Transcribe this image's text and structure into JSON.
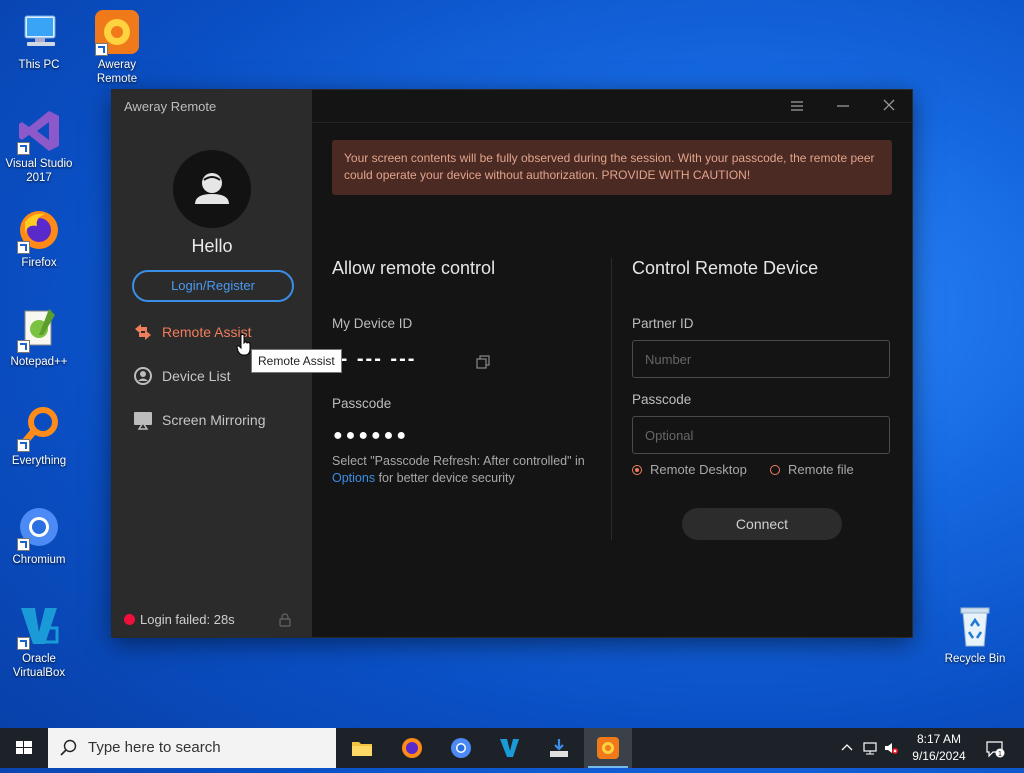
{
  "desktop": {
    "icons": [
      {
        "label": "This PC",
        "icon": "computer-icon"
      },
      {
        "label": "Aweray Remote",
        "icon": "aweray-icon"
      },
      {
        "label": "Visual Studio 2017",
        "icon": "visual-studio-icon"
      },
      {
        "label": "Firefox",
        "icon": "firefox-icon"
      },
      {
        "label": "Notepad++",
        "icon": "notepadpp-icon"
      },
      {
        "label": "Everything",
        "icon": "everything-icon"
      },
      {
        "label": "Chromium",
        "icon": "chromium-icon"
      },
      {
        "label": "Oracle VirtualBox",
        "icon": "virtualbox-icon"
      },
      {
        "label": "Recycle Bin",
        "icon": "recycle-bin-icon"
      }
    ]
  },
  "app": {
    "title": "Aweray Remote",
    "sidebar": {
      "greeting": "Hello",
      "login_button": "Login/Register",
      "nav": [
        {
          "label": "Remote Assist",
          "icon": "remote-assist-icon",
          "active": true
        },
        {
          "label": "Device List",
          "icon": "device-list-icon",
          "active": false
        },
        {
          "label": "Screen Mirroring",
          "icon": "screen-mirroring-icon",
          "active": false
        }
      ],
      "status": "Login failed: 28s"
    },
    "warning": "Your screen contents will be fully observed during the session. With your passcode, the remote peer could operate your device without authorization. PROVIDE WITH CAUTION!",
    "allow": {
      "title": "Allow remote control",
      "device_id_label": "My Device ID",
      "device_id_value": "-- --- ---",
      "passcode_label": "Passcode",
      "passcode_value": "●●●●●●",
      "hint_prefix": "Select \"Passcode Refresh: After controlled\" in ",
      "hint_link": "Options",
      "hint_suffix": " for better device security"
    },
    "control": {
      "title": "Control Remote Device",
      "partner_label": "Partner ID",
      "partner_placeholder": "Number",
      "passcode_label": "Passcode",
      "passcode_placeholder": "Optional",
      "mode_options": [
        {
          "label": "Remote Desktop",
          "selected": true
        },
        {
          "label": "Remote file",
          "selected": false
        }
      ],
      "connect_button": "Connect"
    },
    "tooltip": "Remote Assist",
    "accent_color": "#f07d5b",
    "link_color": "#3a8ee6"
  },
  "taskbar": {
    "search_placeholder": "Type here to search",
    "apps": [
      "file-explorer-icon",
      "firefox-icon",
      "chromium-icon",
      "virtualbox-icon",
      "installer-icon",
      "aweray-icon"
    ],
    "time": "8:17 AM",
    "date": "9/16/2024",
    "notification_count": "1"
  }
}
